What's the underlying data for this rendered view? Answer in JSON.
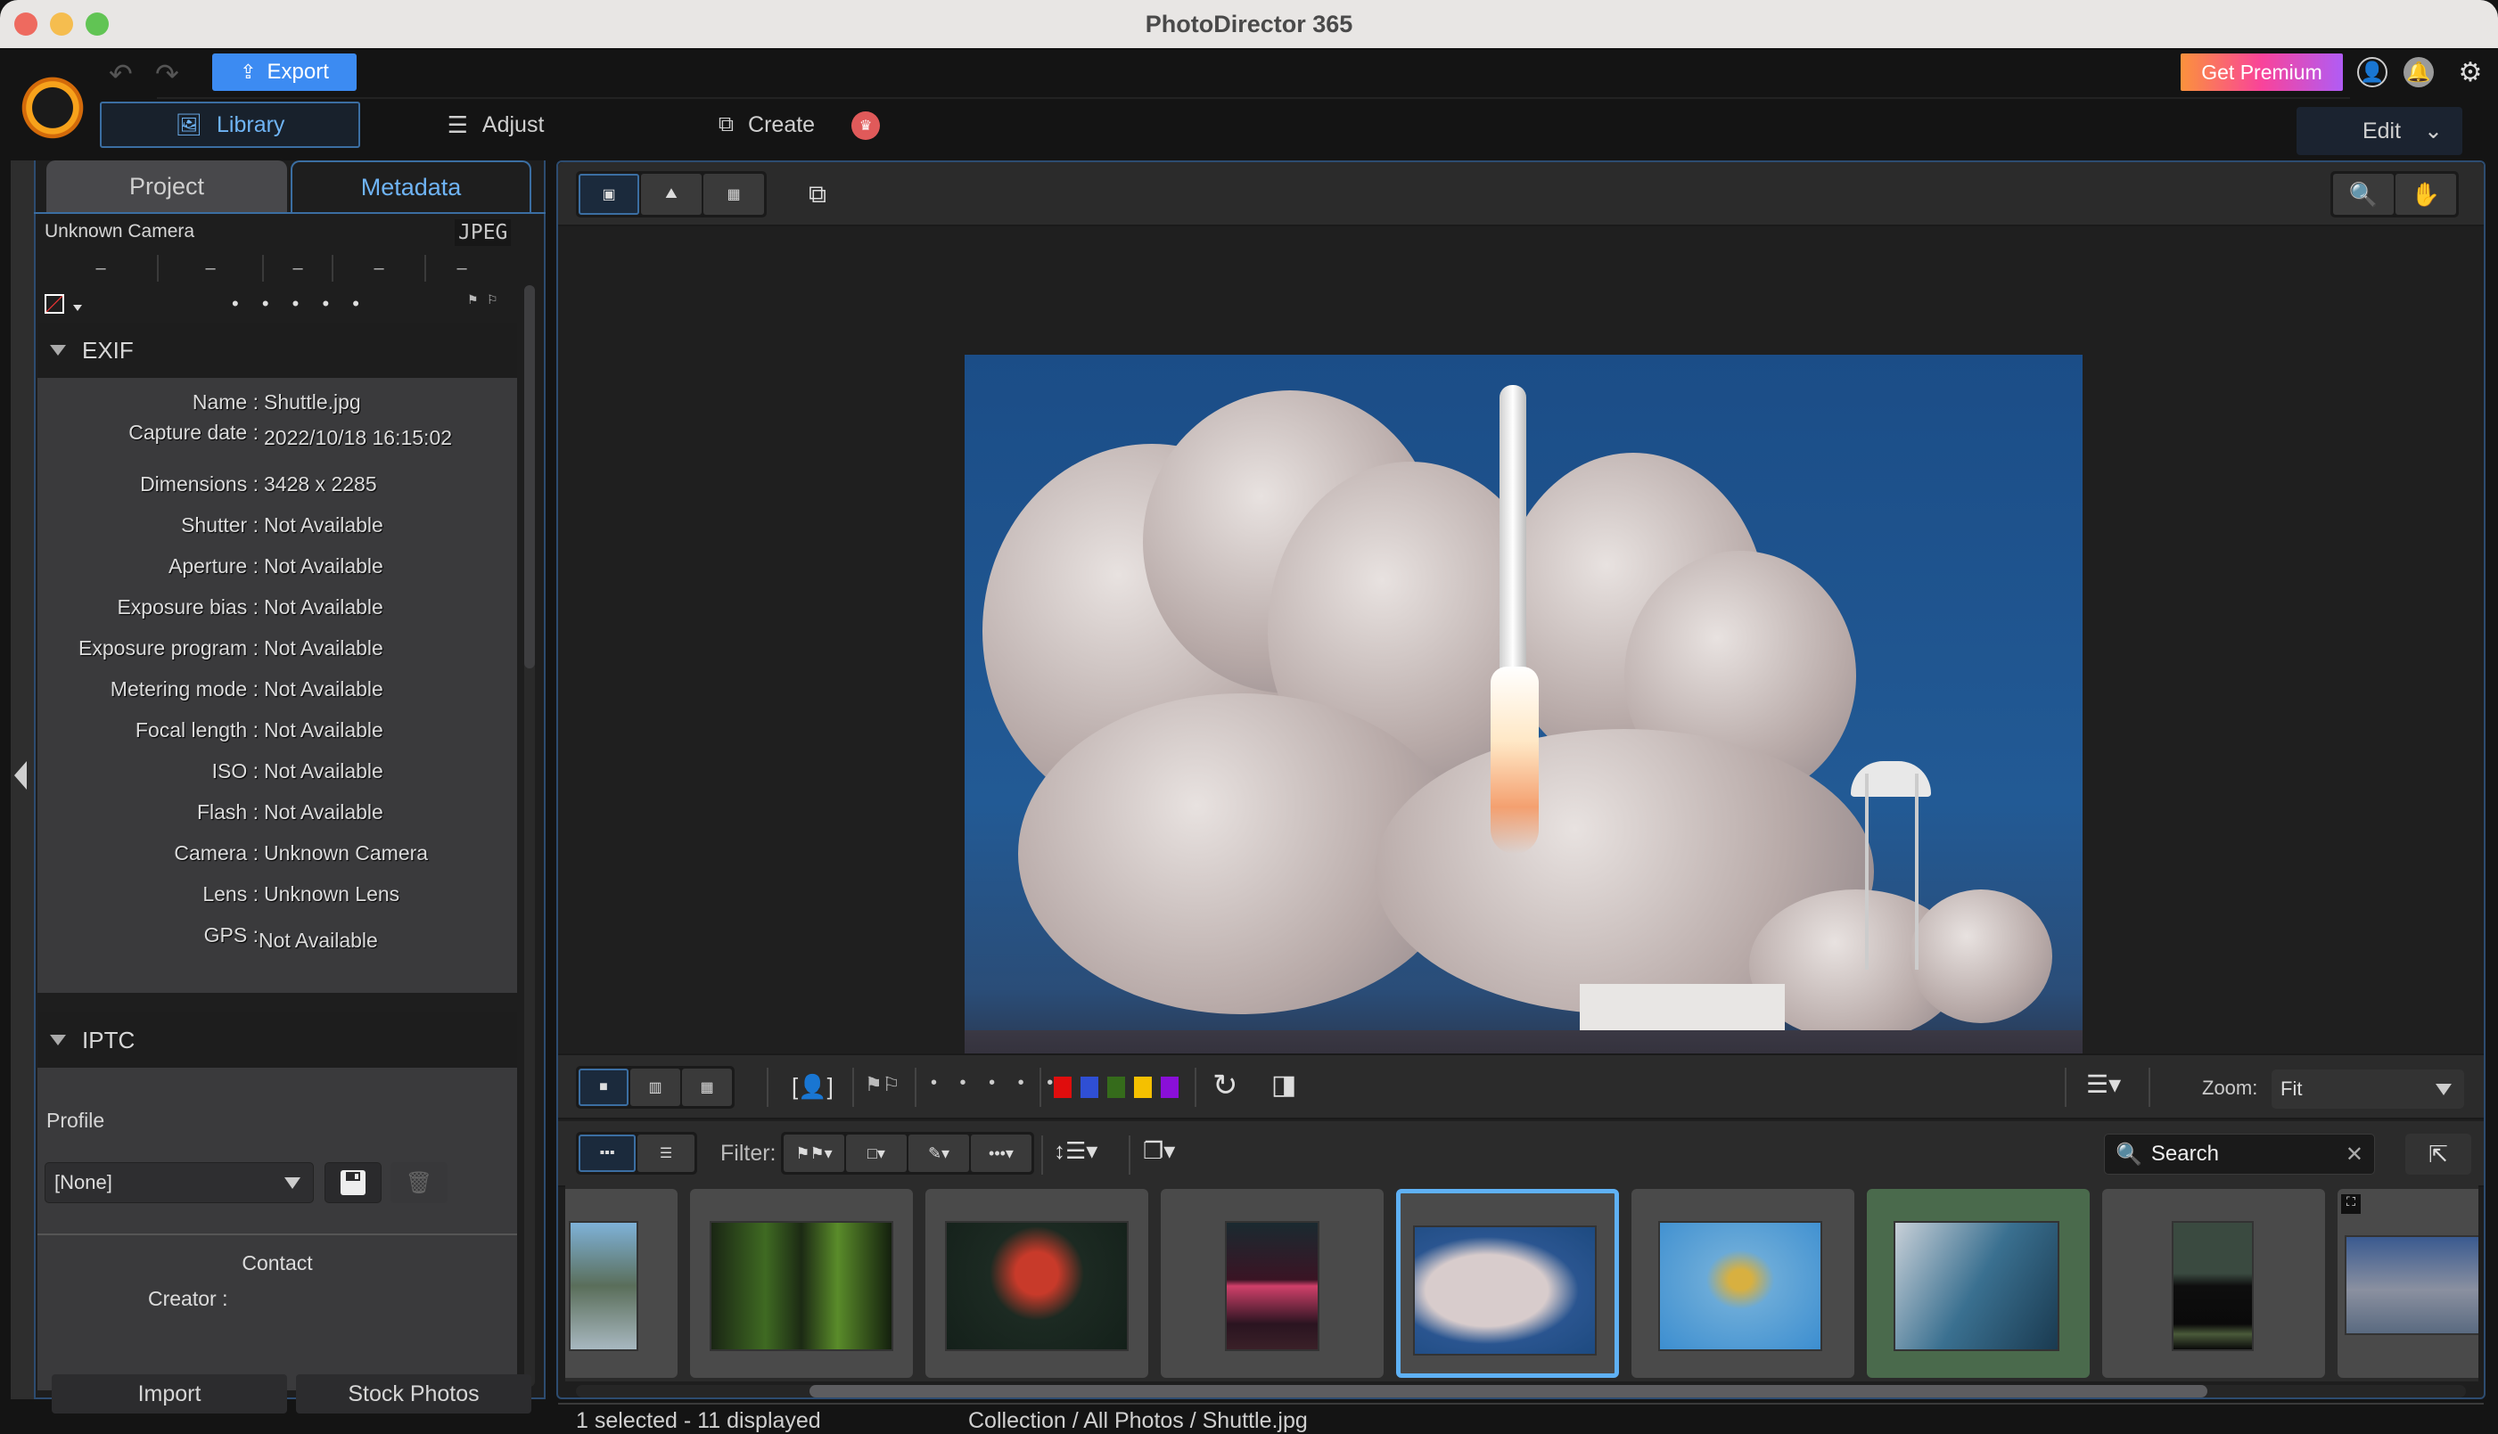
{
  "window": {
    "title": "PhotoDirector 365",
    "traffic_lights": {
      "close": "#ee6a5f",
      "minimize": "#f5bd4f",
      "maximize": "#61c454"
    }
  },
  "header": {
    "export_label": "Export",
    "modes": [
      {
        "label": "Library",
        "icon": "library-icon",
        "active": true
      },
      {
        "label": "Adjust",
        "icon": "sliders-icon",
        "active": false
      },
      {
        "label": "Create",
        "icon": "create-icon",
        "active": false
      }
    ],
    "premium_label": "Get Premium",
    "edit_label": "Edit",
    "accent_color": "#3c8bf2"
  },
  "left_panel": {
    "tabs": [
      {
        "label": "Project",
        "active": false
      },
      {
        "label": "Metadata",
        "active": true
      }
    ],
    "camera_name": "Unknown Camera",
    "file_type": "JPEG",
    "summary_values": [
      "–",
      "–",
      "–",
      "–",
      "–"
    ],
    "rating_dots": "• • • • •",
    "exif": {
      "title": "EXIF",
      "rows": [
        {
          "key": "Name :",
          "value": "Shuttle.jpg"
        },
        {
          "key": "Capture date :",
          "value": "2022/10/18 16:15:02"
        },
        {
          "key": "Dimensions :",
          "value": "3428 x 2285"
        },
        {
          "key": "Shutter :",
          "value": "Not Available"
        },
        {
          "key": "Aperture :",
          "value": "Not Available"
        },
        {
          "key": "Exposure bias :",
          "value": "Not Available"
        },
        {
          "key": "Exposure program :",
          "value": "Not Available"
        },
        {
          "key": "Metering mode :",
          "value": "Not Available"
        },
        {
          "key": "Focal length :",
          "value": "Not Available"
        },
        {
          "key": "ISO :",
          "value": "Not Available"
        },
        {
          "key": "Flash :",
          "value": "Not Available"
        },
        {
          "key": "Camera :",
          "value": "Unknown Camera"
        },
        {
          "key": "Lens :",
          "value": "Unknown Lens"
        },
        {
          "key": "GPS :",
          "value": "Not Available"
        }
      ]
    },
    "iptc": {
      "title": "IPTC",
      "profile_label": "Profile",
      "profile_value": "[None]",
      "contact_label": "Contact",
      "creator_label": "Creator :"
    },
    "footer": {
      "import_label": "Import",
      "stock_label": "Stock Photos"
    }
  },
  "viewer": {
    "view_modes": [
      "loupe-with-filmstrip",
      "loupe",
      "grid"
    ],
    "active_view_mode": 0,
    "tools": [
      "zoom-tool",
      "pan-tool"
    ],
    "compare_modes": [
      "single",
      "compare-two",
      "compare-multi"
    ],
    "color_labels": [
      "#e00d0d",
      "#2f4fd4",
      "#356b1b",
      "#f5c000",
      "#8a0fd8"
    ],
    "zoom_label": "Zoom:",
    "zoom_value": "Fit"
  },
  "filter_bar": {
    "filter_label": "Filter:",
    "search_placeholder": "Search"
  },
  "filmstrip": {
    "thumbnails": [
      {
        "name": "rock-boat",
        "selected": false,
        "marked": false
      },
      {
        "name": "forest",
        "selected": false,
        "marked": false
      },
      {
        "name": "maple-leaf",
        "selected": false,
        "marked": false
      },
      {
        "name": "neon-storefront",
        "selected": false,
        "marked": false
      },
      {
        "name": "Shuttle.jpg",
        "selected": true,
        "marked": false
      },
      {
        "name": "skateboarder",
        "selected": false,
        "marked": false
      },
      {
        "name": "wave",
        "selected": false,
        "marked": true
      },
      {
        "name": "window-light",
        "selected": false,
        "marked": false
      },
      {
        "name": "panorama-360",
        "selected": false,
        "marked": false
      }
    ]
  },
  "status": {
    "count": "1 selected - 11 displayed",
    "path": "Collection / All Photos / Shuttle.jpg"
  }
}
